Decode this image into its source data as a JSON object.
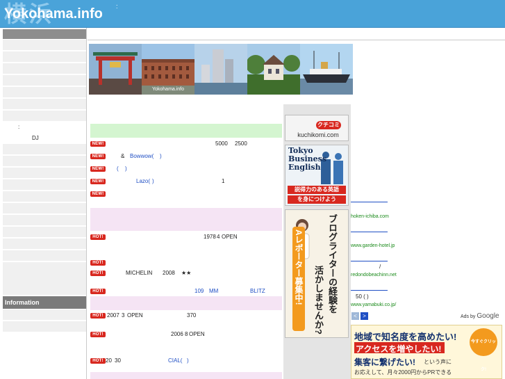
{
  "header": {
    "logo_kanji": "横浜",
    "logo_text": "Yokohama.info",
    "separator": ":"
  },
  "sidebar": {
    "items": [
      "",
      "",
      "",
      "",
      "",
      "",
      "",
      ":",
      "DJ",
      "",
      "",
      "",
      "",
      "",
      "",
      "",
      "",
      "",
      "",
      ""
    ],
    "information_heading": "Information"
  },
  "banner": {
    "caption": "Yokohama.info"
  },
  "news": {
    "new_badge": "NEW!",
    "hot_badge": "HOT!",
    "rows_new": [
      {
        "texts": [
          "5000",
          "2500"
        ]
      },
      {
        "texts": [
          "&",
          "Bowwow(",
          ")"
        ]
      },
      {
        "texts": [
          "(",
          ")"
        ]
      },
      {
        "texts": [
          "Lazo(",
          ")",
          "1"
        ]
      },
      {
        "texts": []
      }
    ],
    "rows_hot_1": [
      {
        "texts": [
          "1978",
          "4",
          "OPEN"
        ]
      },
      {
        "texts": []
      },
      {
        "texts": [
          "MICHELIN",
          "2008",
          "★★"
        ]
      },
      {
        "texts": [
          "109",
          "MM",
          "BLITZ"
        ]
      }
    ],
    "rows_hot_2": [
      {
        "texts": [
          "2007",
          "3",
          "OPEN",
          "370"
        ]
      },
      {
        "texts": [
          "2006",
          "8",
          "OPEN"
        ]
      },
      {
        "texts": [
          "20",
          "30",
          "CIAL(",
          ")"
        ]
      }
    ]
  },
  "ads": {
    "kuchikomi_jp": "クチコミ",
    "kuchikomi_url": "kuchikomi.com",
    "tbe_lines": [
      "Tokyo",
      "Business",
      "English"
    ],
    "tbe_jp_1": "説得力のある英語",
    "tbe_jp_2": "を身につけよう",
    "reporter_1": "ブログライターの経験を",
    "reporter_2": "活かしませんか?",
    "reporter_3": "Aレポーター募集中!",
    "text_ads": [
      {
        "url": "hoken-ichiba.com",
        "desc": ""
      },
      {
        "url": "www.garden-hotel.jp",
        "desc": ""
      },
      {
        "url": "redondobeachinn.net",
        "desc": "/"
      },
      {
        "url": "www.yamabuki.co.jp/",
        "desc": "50 ( )"
      }
    ],
    "ads_by": "Ads by",
    "google": "Google",
    "prev": "<",
    "next": ">",
    "banner2_line1": "地域で知名度を高めたい!",
    "banner2_line2": "アクセスを増やしたい!",
    "banner2_line3": "集客に繋げたい!",
    "banner2_line3b": "という声に",
    "banner2_line4": "お応えして、月々2000円からPRできる",
    "banner2_badge": "今すぐクリック!"
  },
  "colors": {
    "header": "#4aa3d9",
    "badge": "#d8281f",
    "link": "#1f4fc4",
    "section_green": "#d4f5d0",
    "section_pink": "#f5e4f4"
  }
}
